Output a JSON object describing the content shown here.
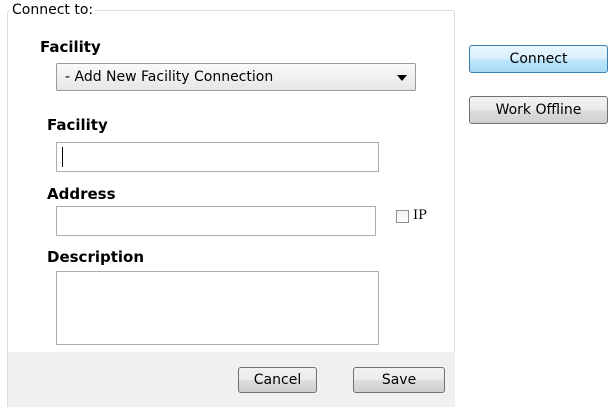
{
  "group_label": "Connect to:",
  "facility_select": {
    "label": "Facility",
    "selected": "- Add New Facility Connection"
  },
  "form": {
    "facility_label": "Facility",
    "facility_value": "",
    "address_label": "Address",
    "address_value": "",
    "ip_label": "IP",
    "description_label": "Description",
    "description_value": ""
  },
  "buttons": {
    "connect": "Connect",
    "work_offline": "Work Offline",
    "cancel": "Cancel",
    "save": "Save"
  }
}
